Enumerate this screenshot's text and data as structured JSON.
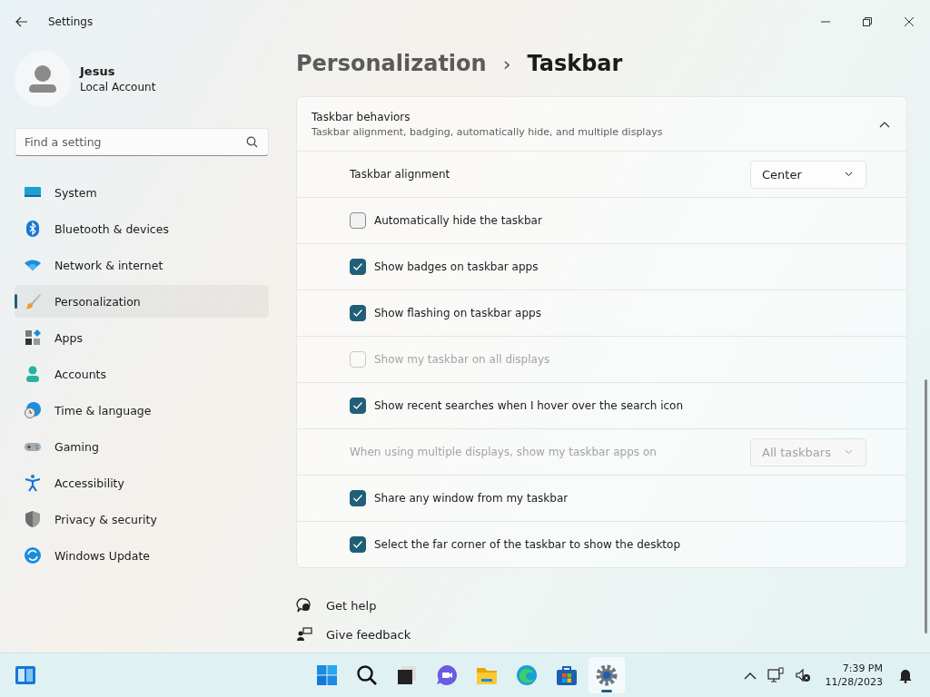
{
  "window": {
    "title": "Settings"
  },
  "user": {
    "name": "Jesus",
    "account": "Local Account"
  },
  "search": {
    "placeholder": "Find a setting"
  },
  "nav": [
    {
      "label": "System",
      "selected": false
    },
    {
      "label": "Bluetooth & devices",
      "selected": false
    },
    {
      "label": "Network & internet",
      "selected": false
    },
    {
      "label": "Personalization",
      "selected": true
    },
    {
      "label": "Apps",
      "selected": false
    },
    {
      "label": "Accounts",
      "selected": false
    },
    {
      "label": "Time & language",
      "selected": false
    },
    {
      "label": "Gaming",
      "selected": false
    },
    {
      "label": "Accessibility",
      "selected": false
    },
    {
      "label": "Privacy & security",
      "selected": false
    },
    {
      "label": "Windows Update",
      "selected": false
    }
  ],
  "breadcrumb": {
    "parent": "Personalization",
    "separator": "›",
    "current": "Taskbar"
  },
  "section": {
    "title": "Taskbar behaviors",
    "subtitle": "Taskbar alignment, badging, automatically hide, and multiple displays",
    "expanded": true,
    "rows": [
      {
        "kind": "dropdown",
        "label": "Taskbar alignment",
        "value": "Center",
        "disabled": false
      },
      {
        "kind": "checkbox",
        "label": "Automatically hide the taskbar",
        "checked": false,
        "disabled": false
      },
      {
        "kind": "checkbox",
        "label": "Show badges on taskbar apps",
        "checked": true,
        "disabled": false
      },
      {
        "kind": "checkbox",
        "label": "Show flashing on taskbar apps",
        "checked": true,
        "disabled": false
      },
      {
        "kind": "checkbox",
        "label": "Show my taskbar on all displays",
        "checked": false,
        "disabled": true
      },
      {
        "kind": "checkbox",
        "label": "Show recent searches when I hover over the search icon",
        "checked": true,
        "disabled": false
      },
      {
        "kind": "dropdown",
        "label": "When using multiple displays, show my taskbar apps on",
        "value": "All taskbars",
        "disabled": true
      },
      {
        "kind": "checkbox",
        "label": "Share any window from my taskbar",
        "checked": true,
        "disabled": false
      },
      {
        "kind": "checkbox",
        "label": "Select the far corner of the taskbar to show the desktop",
        "checked": true,
        "disabled": false
      }
    ]
  },
  "links": [
    "Get help",
    "Give feedback"
  ],
  "taskbar": {
    "apps": [
      {
        "selected": false
      },
      {
        "selected": false
      },
      {
        "selected": false
      },
      {
        "selected": false
      },
      {
        "selected": false
      },
      {
        "selected": false
      },
      {
        "selected": false
      },
      {
        "selected": true
      }
    ],
    "time": "7:39 PM",
    "date": "11/28/2023"
  }
}
